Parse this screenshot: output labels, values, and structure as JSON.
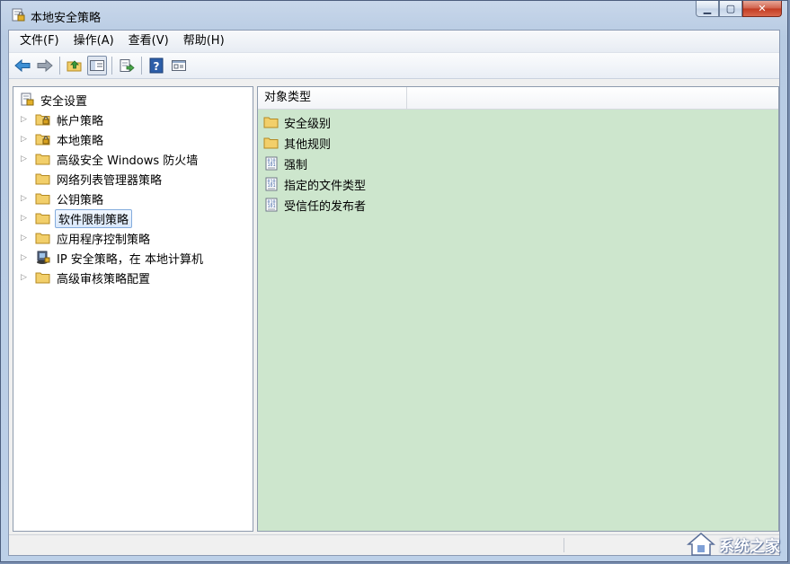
{
  "window": {
    "title": "本地安全策略"
  },
  "menu": [
    {
      "label": "文件(F)"
    },
    {
      "label": "操作(A)"
    },
    {
      "label": "查看(V)"
    },
    {
      "label": "帮助(H)"
    }
  ],
  "toolbar": {
    "buttons": [
      "back-arrow-icon",
      "forward-arrow-icon",
      "up-folder-icon",
      "show-tree-icon",
      "export-list-icon",
      "help-icon",
      "properties-icon"
    ]
  },
  "tree": {
    "root": "安全设置",
    "items": [
      {
        "label": "帐户策略",
        "icon": "locked-folder-icon"
      },
      {
        "label": "本地策略",
        "icon": "locked-folder-icon"
      },
      {
        "label": "高级安全 Windows 防火墙",
        "icon": "folder-icon"
      },
      {
        "label": "网络列表管理器策略",
        "icon": "folder-icon"
      },
      {
        "label": "公钥策略",
        "icon": "folder-icon"
      },
      {
        "label": "软件限制策略",
        "icon": "folder-icon"
      },
      {
        "label": "应用程序控制策略",
        "icon": "folder-icon"
      },
      {
        "label": "IP 安全策略，在 本地计算机",
        "icon": "ip-security-icon"
      },
      {
        "label": "高级审核策略配置",
        "icon": "folder-icon"
      }
    ]
  },
  "list": {
    "column": "对象类型",
    "items": [
      {
        "label": "安全级别",
        "icon": "folder-icon"
      },
      {
        "label": "其他规则",
        "icon": "folder-icon"
      },
      {
        "label": "强制",
        "icon": "policy-icon"
      },
      {
        "label": "指定的文件类型",
        "icon": "policy-icon"
      },
      {
        "label": "受信任的发布者",
        "icon": "policy-icon"
      }
    ]
  },
  "watermark": {
    "text": "系统之家"
  },
  "colors": {
    "list_background": "#cde6cd",
    "folder": "#f2cf6a"
  }
}
